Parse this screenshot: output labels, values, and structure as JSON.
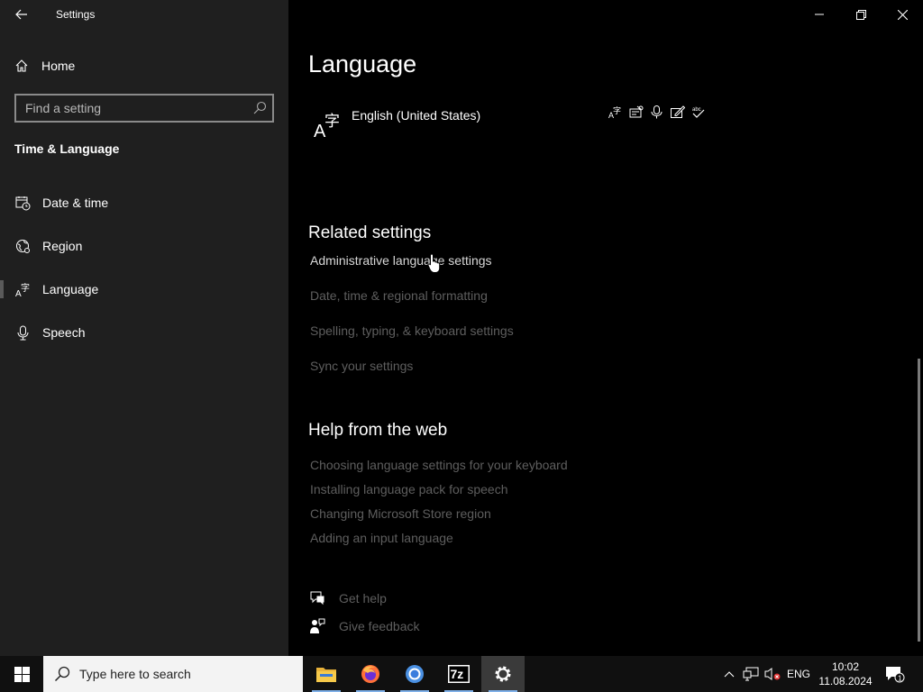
{
  "app": {
    "title": "Settings"
  },
  "sidebar": {
    "home_label": "Home",
    "search_placeholder": "Find a setting",
    "section_title": "Time & Language",
    "items": [
      {
        "label": "Date & time",
        "icon": "calendar-clock-icon"
      },
      {
        "label": "Region",
        "icon": "globe-icon"
      },
      {
        "label": "Language",
        "icon": "language-icon",
        "active": true
      },
      {
        "label": "Speech",
        "icon": "microphone-icon"
      }
    ]
  },
  "main": {
    "title": "Language",
    "language_entry": {
      "name": "English (United States)",
      "features": [
        "display-language-icon",
        "text-to-speech-icon",
        "speech-recognition-icon",
        "handwriting-icon",
        "spellcheck-icon"
      ]
    },
    "related_settings": {
      "heading": "Related settings",
      "links": [
        "Administrative language settings",
        "Date, time & regional formatting",
        "Spelling, typing, & keyboard settings",
        "Sync your settings"
      ]
    },
    "help_web": {
      "heading": "Help from the web",
      "links": [
        "Choosing language settings for your keyboard",
        "Installing language pack for speech",
        "Changing Microsoft Store region",
        "Adding an input language"
      ]
    },
    "get_help": "Get help",
    "give_feedback": "Give feedback"
  },
  "taskbar": {
    "search_placeholder": "Type here to search",
    "apps": [
      "file-explorer-icon",
      "firefox-icon",
      "chrome-icon",
      "7zip-icon",
      "settings-icon"
    ],
    "seven_zip_label": "7z",
    "language": "ENG",
    "time": "10:02",
    "date": "11.08.2024",
    "notification_count": "1"
  },
  "colors": {
    "accent": "#7fb0e8",
    "sidebar_bg": "#1f1f1f",
    "main_bg": "#000000"
  }
}
